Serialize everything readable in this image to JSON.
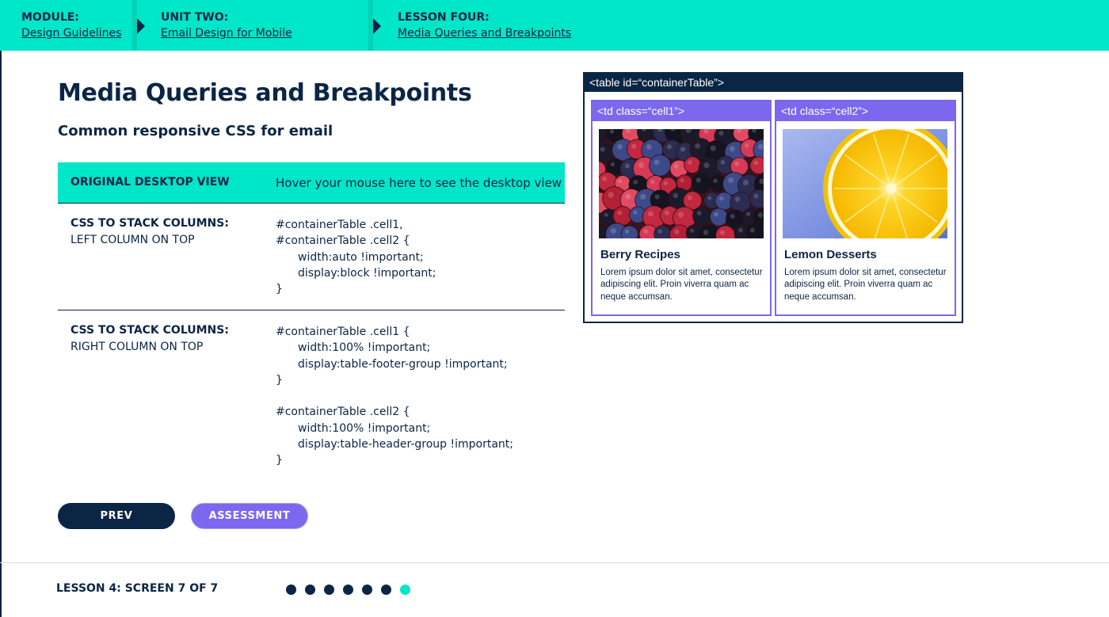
{
  "breadcrumbs": [
    {
      "label": "MODULE:",
      "link": "Design Guidelines"
    },
    {
      "label": "UNIT TWO:",
      "link": "Email Design for Mobile"
    },
    {
      "label": "LESSON FOUR:",
      "link": "Media Queries and Breakpoints"
    }
  ],
  "page": {
    "title": "Media Queries and Breakpoints",
    "subtitle": "Common responsive CSS for email"
  },
  "table": {
    "header": {
      "label": "ORIGINAL DESKTOP VIEW",
      "hint": "Hover your mouse here to see the desktop view"
    },
    "rows": [
      {
        "title": "CSS TO STACK COLUMNS:",
        "subtitle": "LEFT COLUMN ON TOP",
        "code": [
          "#containerTable .cell1,",
          "#containerTable .cell2 {",
          "width:auto !important;",
          "display:block !important;",
          "}"
        ]
      },
      {
        "title": "CSS TO STACK COLUMNS:",
        "subtitle": "RIGHT COLUMN ON TOP",
        "code": [
          "#containerTable .cell1 {",
          "width:100% !important;",
          "display:table-footer-group !important;",
          "}",
          "#containerTable .cell2 {",
          "width:100% !important;",
          "display:table-header-group !important;",
          "}"
        ]
      }
    ]
  },
  "buttons": {
    "prev": "PREV",
    "assessment": "ASSESSMENT"
  },
  "footer": {
    "label": "LESSON 4: SCREEN 7 OF 7",
    "total_screens": 7,
    "current_screen": 7
  },
  "diagram": {
    "table_label": "<table id=“containerTable”>",
    "cells": [
      {
        "label": "<td class=“cell1”>",
        "image": "berries-photo",
        "title": "Berry Recipes",
        "text": "Lorem ipsum dolor sit amet, consectetur adipiscing elit. Proin viverra quam ac neque accumsan."
      },
      {
        "label": "<td class=“cell2”>",
        "image": "lemon-photo",
        "title": "Lemon Desserts",
        "text": "Lorem ipsum dolor sit amet, consectetur adipiscing elit. Proin viverra quam ac neque accumsan."
      }
    ]
  },
  "colors": {
    "navy": "#0b2545",
    "teal": "#00e6c8",
    "purple": "#7b68ee"
  }
}
